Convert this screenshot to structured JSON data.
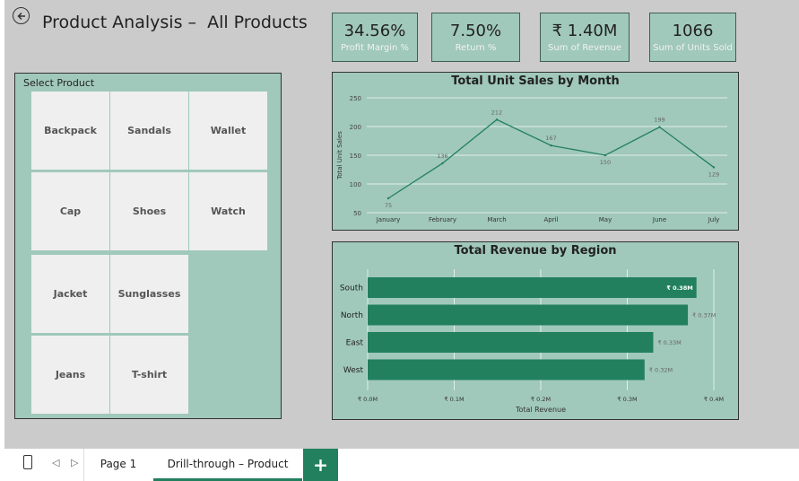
{
  "header": {
    "title": "Product Analysis –  All Products"
  },
  "kpis": [
    {
      "value": "34.56%",
      "label": "Profit Margin %"
    },
    {
      "value": "7.50%",
      "label": "Return %"
    },
    {
      "value": "₹ 1.40M",
      "label": "Sum of Revenue"
    },
    {
      "value": "1066",
      "label": "Sum of Units Sold"
    }
  ],
  "slicer": {
    "title": "Select Product",
    "items": [
      "Backpack",
      "Sandals",
      "Wallet",
      "Cap",
      "Shoes",
      "Watch",
      "Jacket",
      "Sunglasses",
      "Jeans",
      "T-shirt"
    ]
  },
  "colors": {
    "accent": "#22805f",
    "panel": "#a0c8bb",
    "canvas": "#cbcbcb",
    "tile": "#efefef"
  },
  "chart_data": [
    {
      "type": "line",
      "title": "Total Unit Sales by Month",
      "ylabel": "Total Unit Sales",
      "xlabel": "",
      "x": [
        "January",
        "February",
        "March",
        "April",
        "May",
        "June",
        "July"
      ],
      "series": [
        {
          "values": [
            75,
            136,
            212,
            167,
            150,
            199,
            129
          ]
        }
      ],
      "data_labels": [
        "75",
        "136",
        "212",
        "167",
        "150",
        "199",
        "129"
      ],
      "yticks": [
        "50",
        "100",
        "150",
        "200",
        "250"
      ],
      "ylim": [
        50,
        250
      ],
      "grid": true
    },
    {
      "type": "bar",
      "orientation": "horizontal",
      "title": "Total Revenue by Region",
      "xlabel": "Total Revenue",
      "categories": [
        "South",
        "North",
        "East",
        "West"
      ],
      "values": [
        0.38,
        0.37,
        0.33,
        0.32
      ],
      "data_labels": [
        "₹ 0.38M",
        "₹ 0.37M",
        "₹ 0.33M",
        "₹ 0.32M"
      ],
      "xticks": [
        "₹ 0.0M",
        "₹ 0.1M",
        "₹ 0.2M",
        "₹ 0.3M",
        "₹ 0.4M"
      ],
      "xlim": [
        0,
        0.4
      ],
      "grid": true
    }
  ],
  "tabs": {
    "items": [
      "Page 1",
      "Drill-through – Product"
    ],
    "active": "Drill-through – Product",
    "add_label": "+"
  }
}
